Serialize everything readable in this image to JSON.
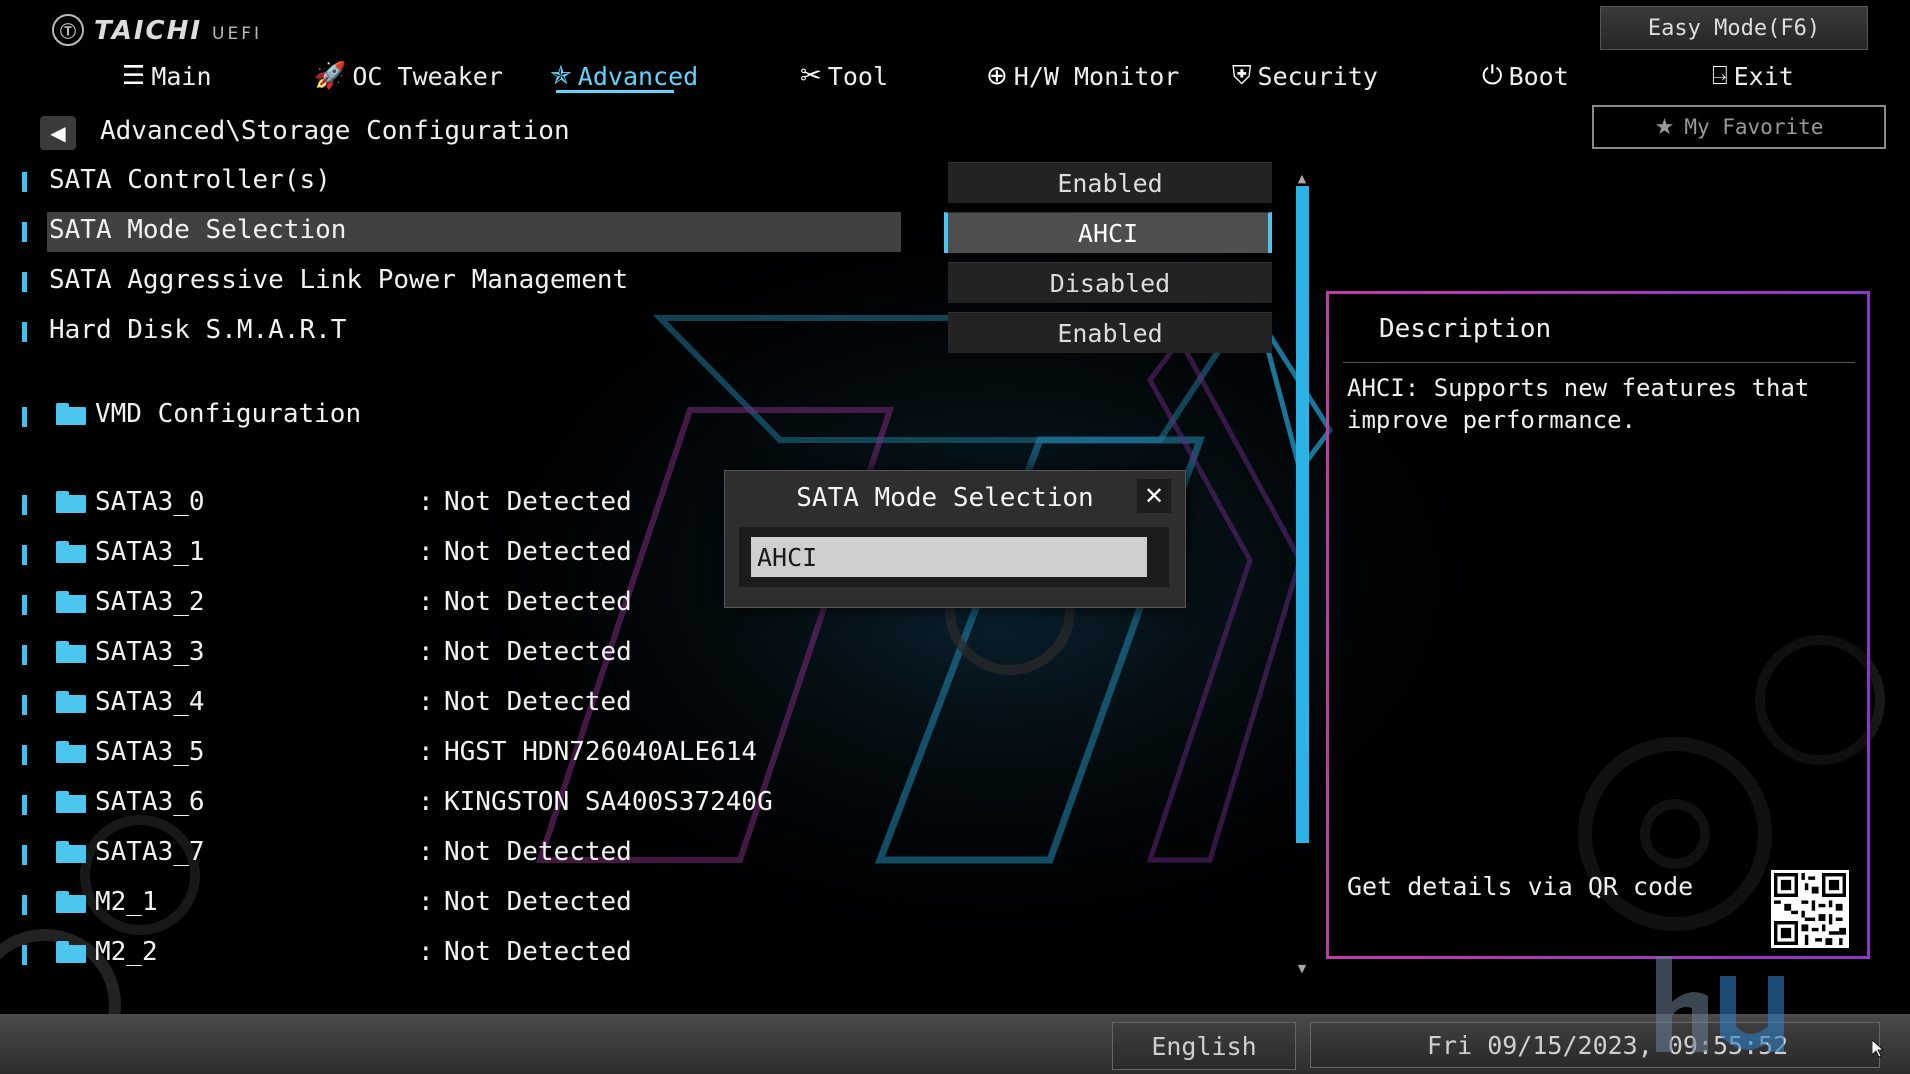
{
  "brand": {
    "name": "TAICHI",
    "sub": "UEFI",
    "mark": "Ⓣ"
  },
  "easy_mode_label": "Easy Mode(F6)",
  "tabs": [
    {
      "label": "Main",
      "icon": "list-icon",
      "glyph": "☰"
    },
    {
      "label": "OC Tweaker",
      "icon": "rocket-icon",
      "glyph": "🚀"
    },
    {
      "label": "Advanced",
      "icon": "star-icon",
      "glyph": "✯"
    },
    {
      "label": "Tool",
      "icon": "tools-icon",
      "glyph": "✂"
    },
    {
      "label": "H/W Monitor",
      "icon": "monitor-icon",
      "glyph": "⊕"
    },
    {
      "label": "Security",
      "icon": "shield-icon",
      "glyph": "⛨"
    },
    {
      "label": "Boot",
      "icon": "power-icon",
      "glyph": "⏻"
    },
    {
      "label": "Exit",
      "icon": "exit-icon",
      "glyph": "⍈"
    }
  ],
  "active_tab": "Advanced",
  "favorite": {
    "label": "My Favorite",
    "glyph": "★"
  },
  "breadcrumb": "Advanced\\Storage Configuration",
  "back_glyph": "◀",
  "settings": [
    {
      "label": "SATA Controller(s)",
      "value": "Enabled"
    },
    {
      "label": "SATA Mode Selection",
      "value": "AHCI"
    },
    {
      "label": "SATA Aggressive Link Power Management",
      "value": "Disabled"
    },
    {
      "label": "Hard Disk S.M.A.R.T",
      "value": "Enabled"
    }
  ],
  "folder_item": "VMD Configuration",
  "ports_sep": ":",
  "ports": [
    {
      "label": "SATA3_0",
      "value": "Not Detected"
    },
    {
      "label": "SATA3_1",
      "value": "Not Detected"
    },
    {
      "label": "SATA3_2",
      "value": "Not Detected"
    },
    {
      "label": "SATA3_3",
      "value": "Not Detected"
    },
    {
      "label": "SATA3_4",
      "value": "Not Detected"
    },
    {
      "label": "SATA3_5",
      "value": "HGST HDN726040ALE614"
    },
    {
      "label": "SATA3_6",
      "value": "KINGSTON SA400S37240G"
    },
    {
      "label": "SATA3_7",
      "value": "Not Detected"
    },
    {
      "label": "M2_1",
      "value": "Not Detected"
    },
    {
      "label": "M2_2",
      "value": "Not Detected"
    }
  ],
  "scroll": {
    "up": "▲",
    "down": "▼"
  },
  "description": {
    "title": "Description",
    "text": "AHCI: Supports new features that improve performance.",
    "qr_label": "Get details via QR code"
  },
  "popup": {
    "title": "SATA Mode Selection",
    "option": "AHCI",
    "close": "✕"
  },
  "footer": {
    "language": "English",
    "datetime": "Fri 09/15/2023, 09:55:52"
  },
  "colors": {
    "accent": "#5fd4ff",
    "marker": "#39c3f5",
    "folder": "#4cc6ef",
    "panel_border": "#c23aa8"
  }
}
